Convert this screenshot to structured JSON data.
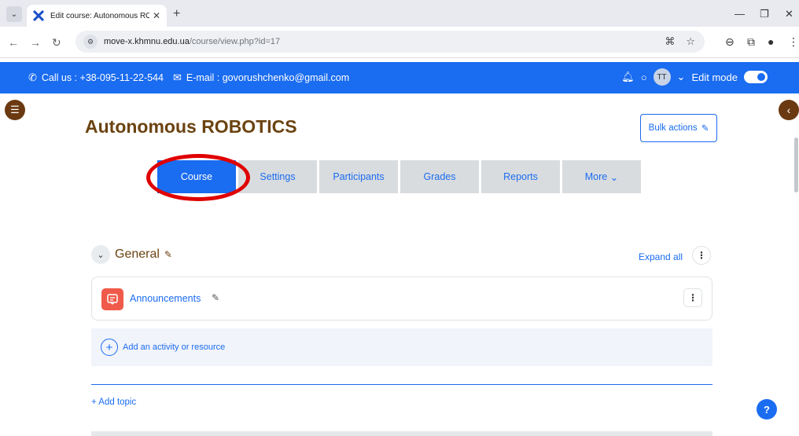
{
  "browser": {
    "tab_title": "Edit course: Autonomous ROBOTIC",
    "url_host": "move-x.khmnu.edu.ua",
    "url_path": "/course/view.php?id=17"
  },
  "topbar": {
    "contact_text": "Call us : +38-095-11-22-544",
    "email_text": "E-mail : govorushchenko@gmail.com",
    "avatar_initials": "TT",
    "edit_mode_label": "Edit mode"
  },
  "course": {
    "title": "Autonomous ROBOTICS",
    "bulk_actions_label": "Bulk actions"
  },
  "nav_tabs": [
    {
      "label": "Course"
    },
    {
      "label": "Settings"
    },
    {
      "label": "Participants"
    },
    {
      "label": "Grades"
    },
    {
      "label": "Reports"
    },
    {
      "label": "More"
    }
  ],
  "section": {
    "title": "General",
    "expand_all_label": "Expand all",
    "activity_name": "Announcements",
    "add_activity_label": "Add an activity or resource",
    "add_topic_label": "Add topic"
  },
  "help_label": "?",
  "colors": {
    "brand_blue": "#1a6cf0",
    "course_brown": "#6b4310",
    "announcement_red": "#f05a4a",
    "highlight_red": "#e00000"
  }
}
